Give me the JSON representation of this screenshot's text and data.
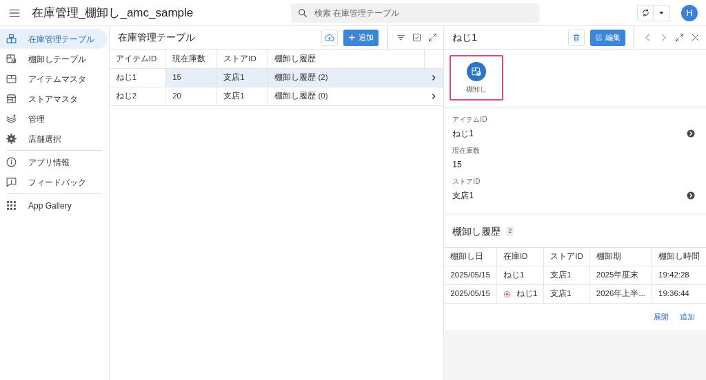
{
  "app_bar": {
    "title": "在庫管理_棚卸し_amc_sample",
    "search": {
      "placeholder": "検索 在庫管理テーブル"
    },
    "avatar": "H"
  },
  "sidebar": {
    "sections": [
      [
        {
          "label": "在庫管理テーブル",
          "kind": "boxes",
          "selected": true
        },
        {
          "label": "棚卸しテーブル",
          "kind": "boxcheck",
          "selected": false
        },
        {
          "label": "アイテムマスタ",
          "kind": "box",
          "selected": false
        },
        {
          "label": "ストアマスタ",
          "kind": "store",
          "selected": false
        },
        {
          "label": "管理",
          "kind": "layers",
          "selected": false
        },
        {
          "label": "店舗選択",
          "kind": "gear",
          "selected": false
        }
      ],
      [
        {
          "label": "アプリ情報",
          "kind": "info",
          "selected": false
        },
        {
          "label": "フィードバック",
          "kind": "feedback",
          "selected": false
        }
      ],
      [
        {
          "label": "App Gallery",
          "kind": "grid",
          "selected": false
        }
      ]
    ]
  },
  "table_view": {
    "title": "在庫管理テーブル",
    "add_button": "追加",
    "columns": [
      "アイテムID",
      "現在庫数",
      "ストアID",
      "棚卸し履歴"
    ],
    "rows": [
      {
        "cells": [
          "ねじ1",
          "15",
          "支店1",
          "棚卸し履歴 (2)"
        ],
        "selected": true
      },
      {
        "cells": [
          "ねじ2",
          "20",
          "支店1",
          "棚卸し履歴 (0)"
        ],
        "selected": false
      }
    ]
  },
  "detail": {
    "title": "ねじ1",
    "edit_button": "編集",
    "action": {
      "label": "棚卸し"
    },
    "fields": [
      {
        "label": "アイテムID",
        "value": "ねじ1",
        "link": true
      },
      {
        "label": "現在庫数",
        "value": "15",
        "link": false
      },
      {
        "label": "ストアID",
        "value": "支店1",
        "link": true
      }
    ],
    "related": {
      "title": "棚卸し履歴",
      "count": "2",
      "columns": [
        "棚卸し日",
        "在庫ID",
        "ストアID",
        "棚卸期",
        "棚卸し時間"
      ],
      "rows": [
        {
          "cells": [
            "2025/05/15",
            "ねじ1",
            "支店1",
            "2025年度末",
            "19:42:28"
          ],
          "alert": false
        },
        {
          "cells": [
            "2025/05/15",
            "ねじ1",
            "支店1",
            "2026年上半...",
            "19:36:44"
          ],
          "alert": true
        }
      ],
      "links": [
        "展開",
        "追加"
      ]
    }
  }
}
